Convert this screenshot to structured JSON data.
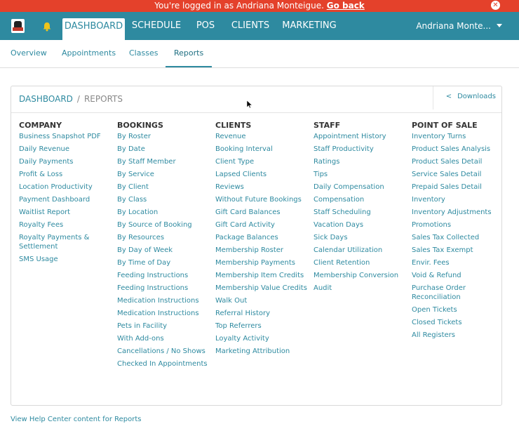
{
  "banner": {
    "text": "You're logged in as Andriana Monteigue. ",
    "link": "Go back",
    "close": "✕"
  },
  "topnav": {
    "tabs": [
      {
        "label": "DASHBOARD",
        "active": true
      },
      {
        "label": "SCHEDULE",
        "active": false
      },
      {
        "label": "POS",
        "active": false
      },
      {
        "label": "CLIENTS",
        "active": false
      },
      {
        "label": "MARKETING",
        "active": false
      }
    ],
    "user": "Andriana Monte..."
  },
  "subnav": {
    "tabs": [
      {
        "label": "Overview",
        "active": false
      },
      {
        "label": "Appointments",
        "active": false
      },
      {
        "label": "Classes",
        "active": false
      },
      {
        "label": "Reports",
        "active": true
      }
    ]
  },
  "breadcrumb": {
    "root": "DASHBOARD",
    "sep": "/",
    "current": "REPORTS"
  },
  "downloads": {
    "chevron": "<",
    "label": "Downloads"
  },
  "columns": [
    {
      "title": "COMPANY",
      "links": [
        "Business Snapshot PDF",
        "Daily Revenue",
        "Daily Payments",
        "Profit & Loss",
        "Location Productivity",
        "Payment Dashboard",
        "Waitlist Report",
        "Royalty Fees",
        "Royalty Payments & Settlement",
        "SMS Usage"
      ]
    },
    {
      "title": "BOOKINGS",
      "links": [
        "By Roster",
        "By Date",
        "By Staff Member",
        "By Service",
        "By Client",
        "By Class",
        "By Location",
        "By Source of Booking",
        "By Resources",
        "By Day of Week",
        "By Time of Day",
        "Feeding Instructions",
        "Feeding Instructions",
        "Medication Instructions",
        "Medication Instructions",
        "Pets in Facility",
        "With Add-ons",
        "Cancellations / No Shows",
        "Checked In Appointments"
      ]
    },
    {
      "title": "CLIENTS",
      "links": [
        "Revenue",
        "Booking Interval",
        "Client Type",
        "Lapsed Clients",
        "Reviews",
        "Without Future Bookings",
        "Gift Card Balances",
        "Gift Card Activity",
        "Package Balances",
        "Membership Roster",
        "Membership Payments",
        "Membership Item Credits",
        "Membership Value Credits",
        "Walk Out",
        "Referral History",
        "Top Referrers",
        "Loyalty Activity",
        "Marketing Attribution"
      ]
    },
    {
      "title": "STAFF",
      "links": [
        "Appointment History",
        "Staff Productivity",
        "Ratings",
        "Tips",
        "Daily Compensation",
        "Compensation",
        "Staff Scheduling",
        "Vacation Days",
        "Sick Days",
        "Calendar Utilization",
        "Client Retention",
        "Membership Conversion",
        "Audit"
      ]
    },
    {
      "title": "POINT OF SALE",
      "links": [
        "Inventory Turns",
        "Product Sales Analysis",
        "Product Sales Detail",
        "Service Sales Detail",
        "Prepaid Sales Detail",
        "Inventory",
        "Inventory Adjustments",
        "Promotions",
        "Sales Tax Collected",
        "Sales Tax Exempt",
        "Envir. Fees",
        "Void & Refund",
        "Purchase Order Reconciliation",
        "Open Tickets",
        "Closed Tickets",
        "All Registers"
      ]
    }
  ],
  "help_link": "View Help Center content for Reports",
  "colors": {
    "banner": "#e4412b",
    "nav": "#2e8aa0",
    "link": "#2e8aa0"
  }
}
